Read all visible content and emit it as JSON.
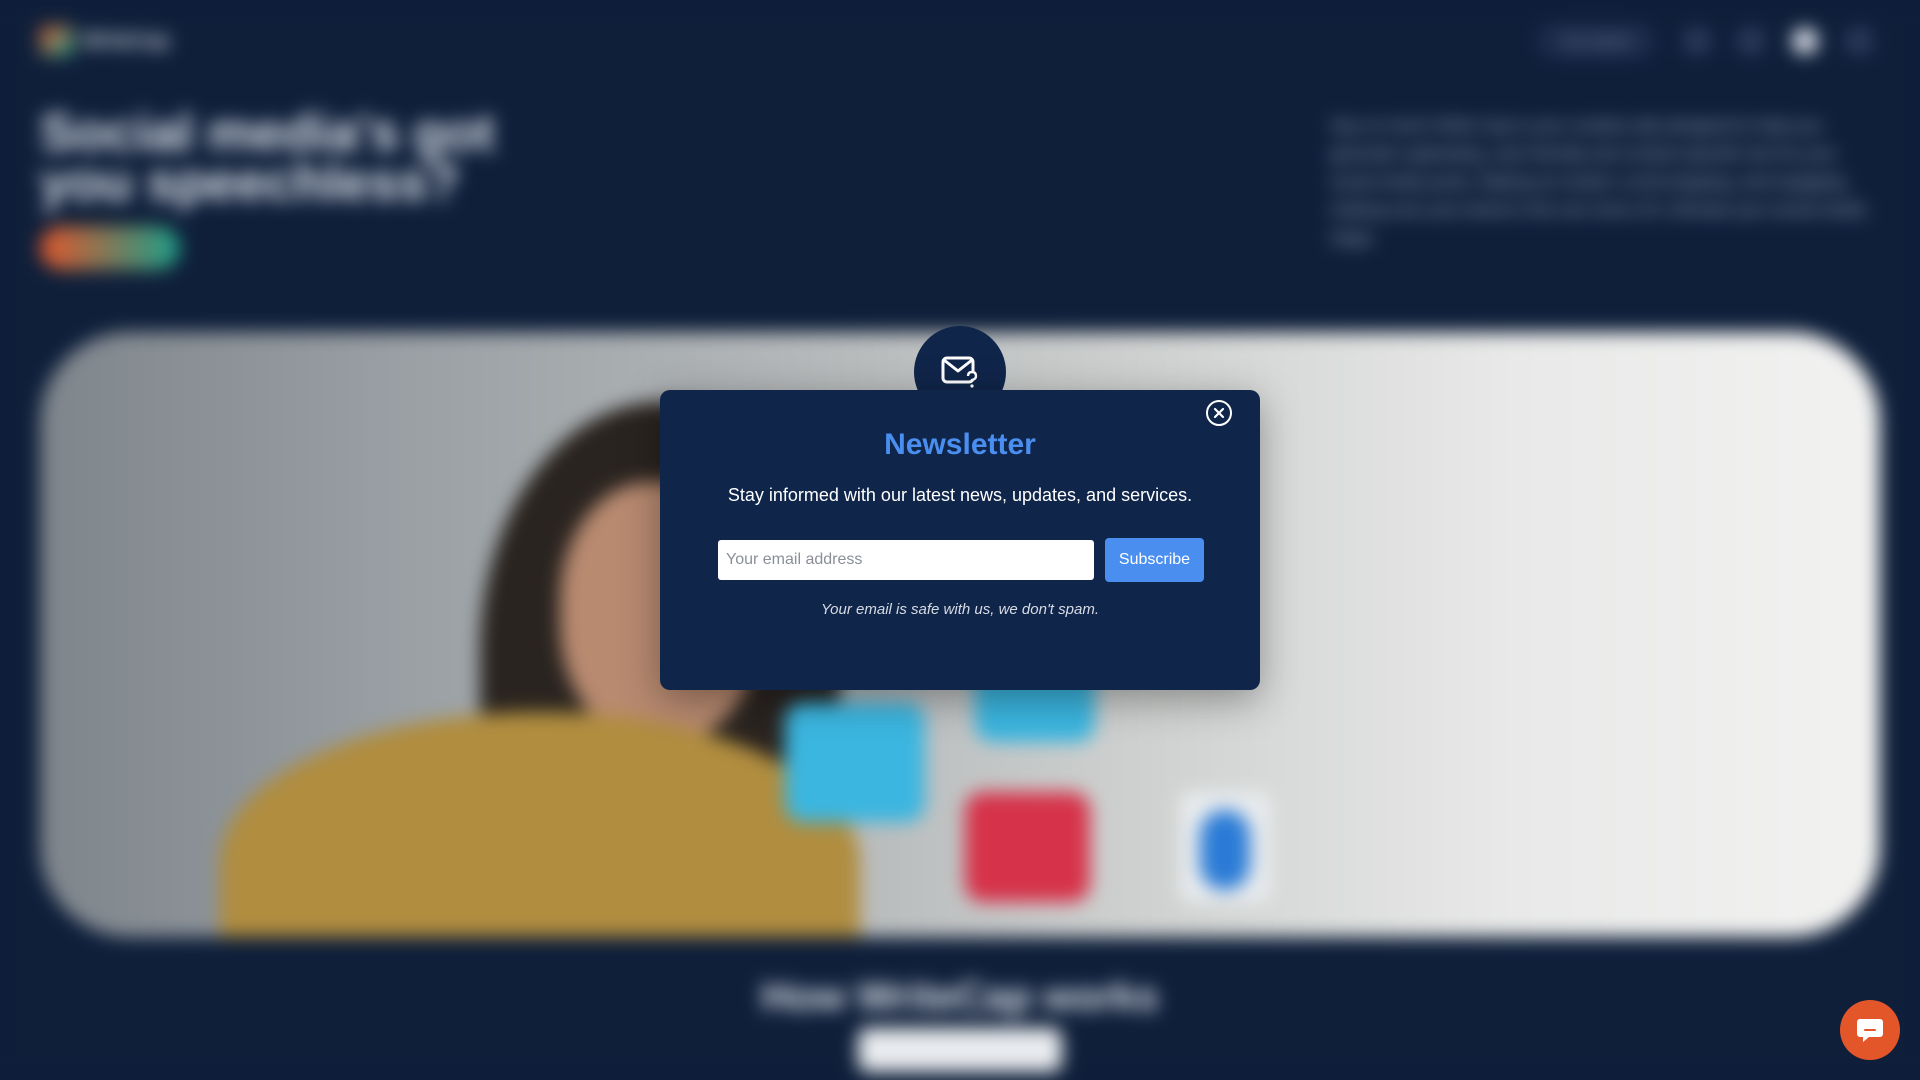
{
  "background": {
    "logo_text": "WriteCap",
    "nav_pill_label": "Get started",
    "hero_title": "Social media's got you speechless?",
    "hero_copy": "Say no more! Write Cap is your creative ally designed to help you generate captivating, user-friendly and content-specific text for your social media posts. Making an instant, scroll-stopping, and engaging, making sure your brand is the one more of it. Elevate your social media stage.",
    "section_title": "How WriteCap works"
  },
  "newsletter": {
    "title": "Newsletter",
    "subtitle": "Stay informed with our latest news, updates, and services.",
    "email_placeholder": "Your email address",
    "subscribe_label": "Subscribe",
    "note": "Your email is safe with us, we don't spam."
  },
  "colors": {
    "page_bg": "#0f1f3a",
    "modal_bg": "#10254a",
    "accent_blue": "#4a8ff0",
    "chat_orange": "#e2562a"
  },
  "icons": {
    "badge": "mail-question-icon",
    "close": "close-circle-icon",
    "chat": "chat-icon"
  }
}
